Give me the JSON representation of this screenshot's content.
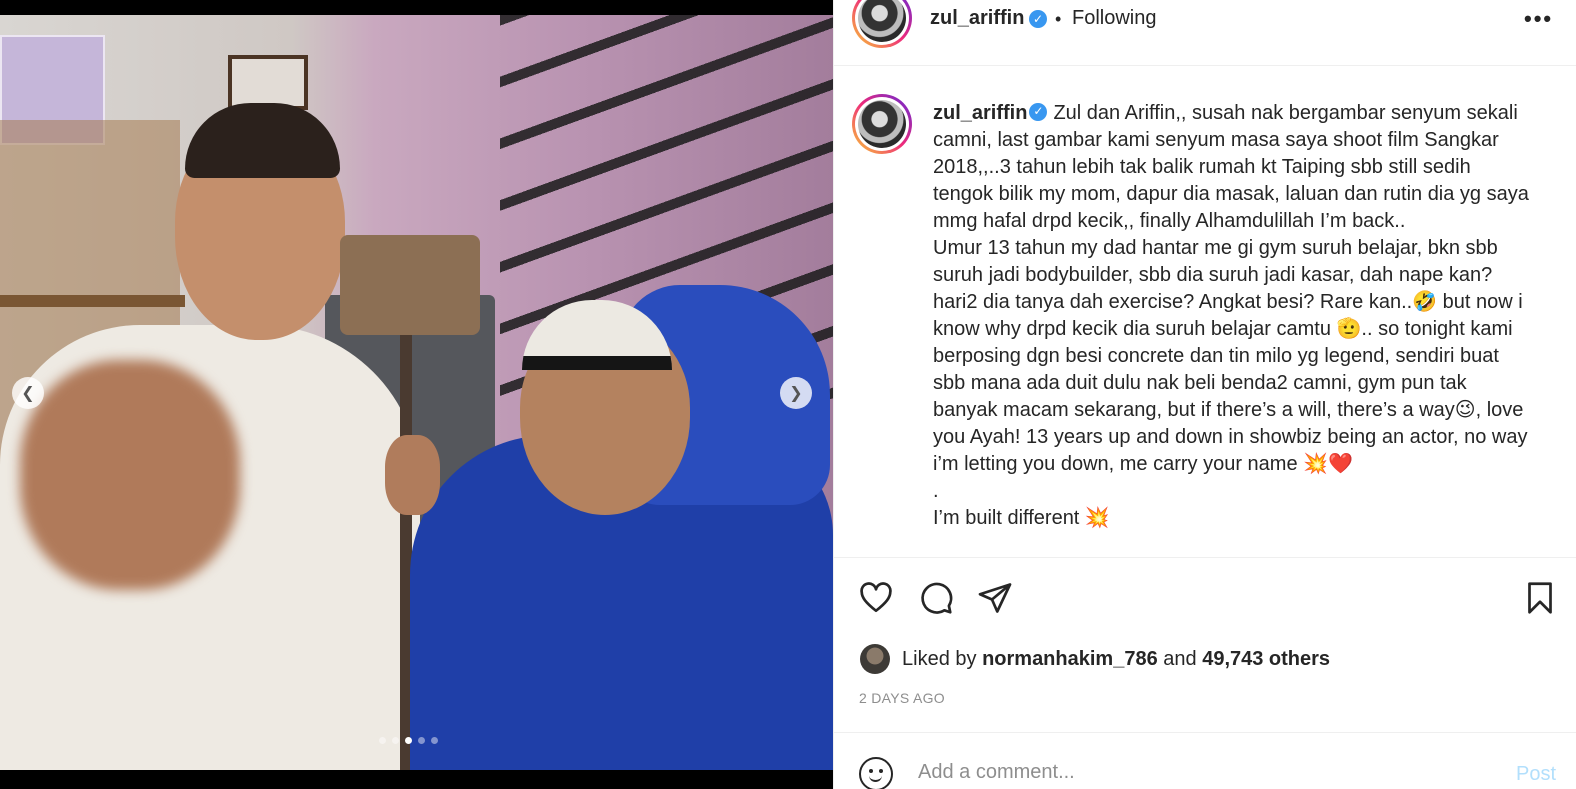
{
  "post": {
    "username": "zul_ariffin",
    "follow_status": "Following",
    "separator": "•",
    "more_icon": "more-horizontal-icon",
    "verified_icon": "verified-badge-icon"
  },
  "media": {
    "carousel_dots": 5,
    "active_dot_index": 2,
    "prev_icon": "chevron-left-icon",
    "next_icon": "chevron-right-icon"
  },
  "caption": {
    "username": "zul_ariffin",
    "lines": [
      "Zul dan Ariffin,, susah nak bergambar senyum sekali",
      "camni, last gambar kami senyum masa saya shoot film Sangkar",
      "2018,,..3 tahun lebih tak balik rumah kt Taiping sbb still sedih",
      "tengok bilik my mom, dapur dia masak, laluan dan rutin dia yg saya",
      "mmg hafal drpd kecik,, finally Alhamdulillah I’m back..",
      "Umur 13 tahun my dad hantar me gi gym suruh belajar, bkn sbb",
      "suruh jadi bodybuilder, sbb dia suruh jadi kasar, dah nape kan?",
      "hari2 dia tanya dah exercise? Angkat besi? Rare kan..🤣 but now i",
      "know why drpd kecik dia suruh belajar camtu 🫡.. so tonight kami",
      "berposing dgn besi concrete dan tin milo yg legend, sendiri buat",
      "sbb mana ada duit dulu nak beli benda2 camni, gym pun tak",
      "banyak macam sekarang, but if there’s a will, there’s a way😉, love",
      "you Ayah! 13 years up and down in showbiz being an actor, no way",
      "i’m letting you down, me carry your name 💥❤️",
      ".",
      "I’m built different 💥"
    ]
  },
  "actions": {
    "like_icon": "heart-icon",
    "comment_icon": "comment-icon",
    "share_icon": "send-icon",
    "save_icon": "bookmark-icon"
  },
  "likes": {
    "prefix": "Liked by",
    "user": "normanhakim_786",
    "conjunction": "and",
    "others": "49,743 others"
  },
  "timestamp": "2 DAYS AGO",
  "comment_box": {
    "placeholder": "Add a comment...",
    "post_label": "Post",
    "emoji_icon": "emoji-smiley-icon"
  },
  "colors": {
    "verified": "#3897f0",
    "post_button_disabled": "#b2dffc",
    "muted_text": "#8e8e8e",
    "primary_text": "#262626"
  }
}
